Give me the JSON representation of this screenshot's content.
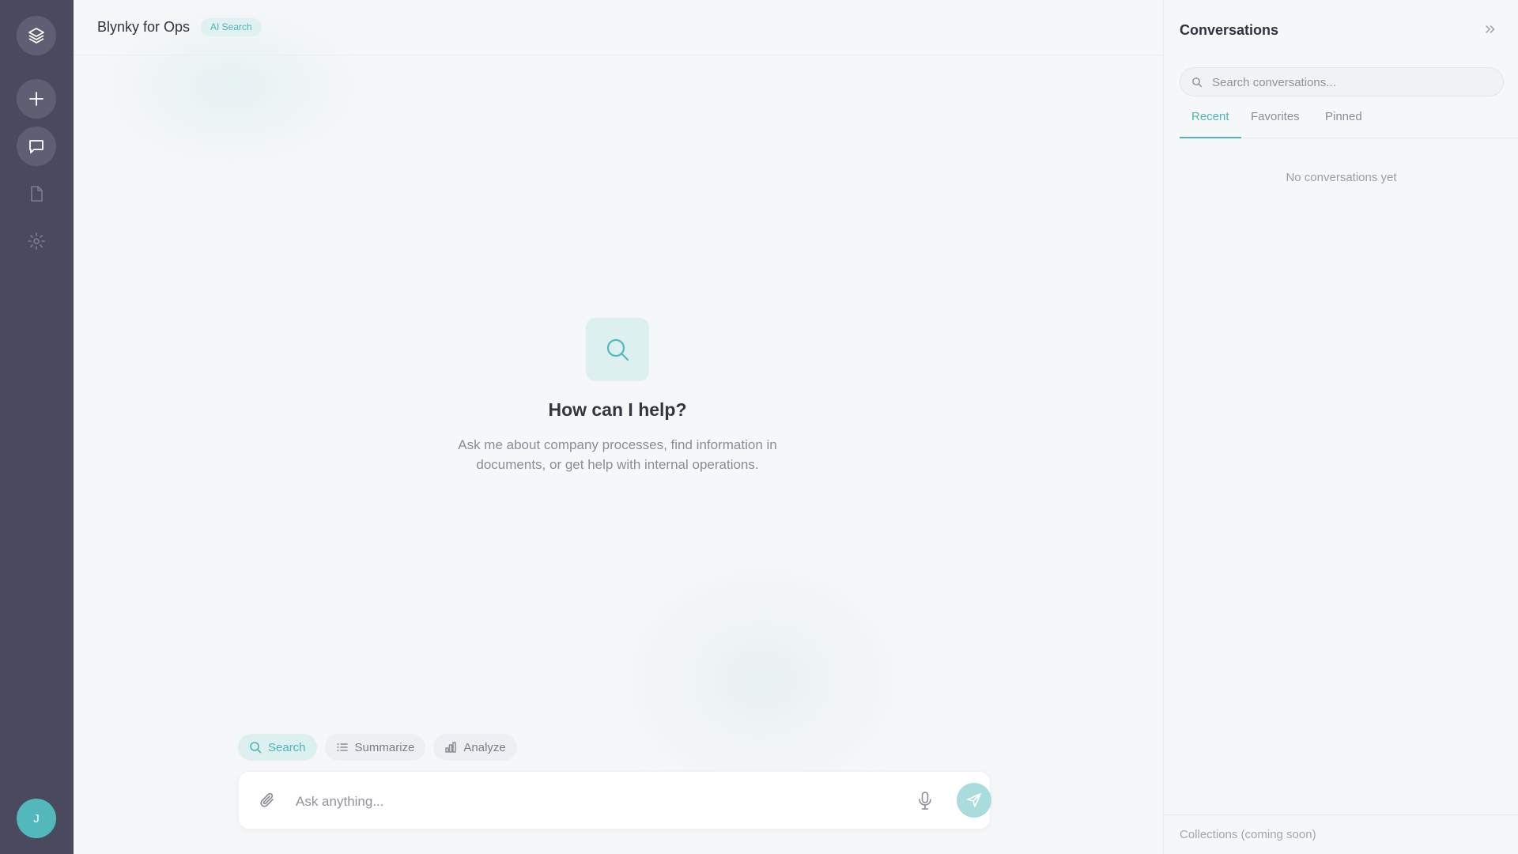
{
  "rail": {
    "avatar_initial": "J",
    "items": [
      {
        "icon": "layers-icon"
      },
      {
        "icon": "plus-icon"
      },
      {
        "icon": "chat-icon"
      },
      {
        "icon": "document-icon"
      },
      {
        "icon": "gear-icon"
      }
    ]
  },
  "header": {
    "title": "Blynky for Ops",
    "badge": "AI Search"
  },
  "hero": {
    "title": "How can I help?",
    "subtitle": "Ask me about company processes, find information in documents, or get help with internal operations."
  },
  "modes": [
    {
      "label": "Search",
      "icon": "search-icon",
      "active": true
    },
    {
      "label": "Summarize",
      "icon": "list-icon",
      "active": false
    },
    {
      "label": "Analyze",
      "icon": "bar-chart-icon",
      "active": false
    }
  ],
  "composer": {
    "placeholder": "Ask anything...",
    "value": ""
  },
  "panel": {
    "title": "Conversations",
    "search_placeholder": "Search conversations...",
    "tabs": [
      {
        "label": "Recent",
        "active": true
      },
      {
        "label": "Favorites",
        "active": false
      },
      {
        "label": "Pinned",
        "active": false
      }
    ],
    "empty_text": "No conversations yet",
    "footer": "Collections (coming soon)"
  },
  "colors": {
    "accent": "#4fb3b5",
    "rail": "#4a4a5f",
    "background": "#f6f7f9"
  }
}
